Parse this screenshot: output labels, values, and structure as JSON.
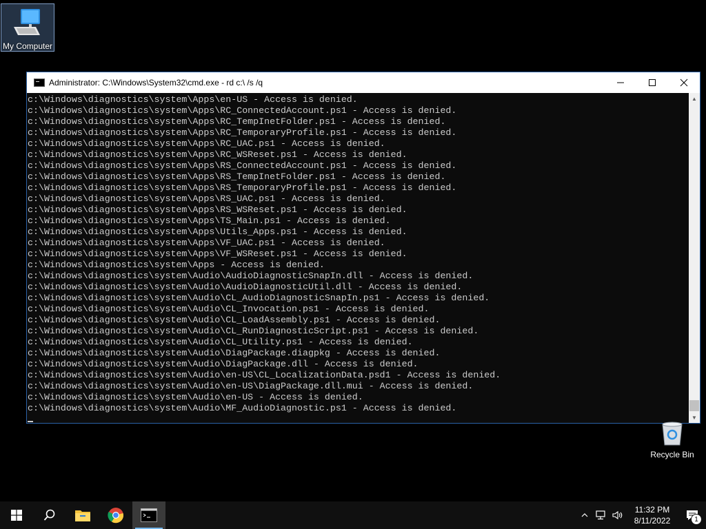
{
  "desktop": {
    "my_computer_label": "My Computer",
    "recycle_bin_label": "Recycle Bin"
  },
  "window": {
    "title": "Administrator: C:\\Windows\\System32\\cmd.exe - rd  c:\\ /s /q",
    "minimize_glyph": "—",
    "maximize_glyph": "☐",
    "close_glyph": "✕"
  },
  "console": {
    "lines": [
      "c:\\Windows\\diagnostics\\system\\Apps\\en-US - Access is denied.",
      "c:\\Windows\\diagnostics\\system\\Apps\\RC_ConnectedAccount.ps1 - Access is denied.",
      "c:\\Windows\\diagnostics\\system\\Apps\\RC_TempInetFolder.ps1 - Access is denied.",
      "c:\\Windows\\diagnostics\\system\\Apps\\RC_TemporaryProfile.ps1 - Access is denied.",
      "c:\\Windows\\diagnostics\\system\\Apps\\RC_UAC.ps1 - Access is denied.",
      "c:\\Windows\\diagnostics\\system\\Apps\\RC_WSReset.ps1 - Access is denied.",
      "c:\\Windows\\diagnostics\\system\\Apps\\RS_ConnectedAccount.ps1 - Access is denied.",
      "c:\\Windows\\diagnostics\\system\\Apps\\RS_TempInetFolder.ps1 - Access is denied.",
      "c:\\Windows\\diagnostics\\system\\Apps\\RS_TemporaryProfile.ps1 - Access is denied.",
      "c:\\Windows\\diagnostics\\system\\Apps\\RS_UAC.ps1 - Access is denied.",
      "c:\\Windows\\diagnostics\\system\\Apps\\RS_WSReset.ps1 - Access is denied.",
      "c:\\Windows\\diagnostics\\system\\Apps\\TS_Main.ps1 - Access is denied.",
      "c:\\Windows\\diagnostics\\system\\Apps\\Utils_Apps.ps1 - Access is denied.",
      "c:\\Windows\\diagnostics\\system\\Apps\\VF_UAC.ps1 - Access is denied.",
      "c:\\Windows\\diagnostics\\system\\Apps\\VF_WSReset.ps1 - Access is denied.",
      "c:\\Windows\\diagnostics\\system\\Apps - Access is denied.",
      "c:\\Windows\\diagnostics\\system\\Audio\\AudioDiagnosticSnapIn.dll - Access is denied.",
      "c:\\Windows\\diagnostics\\system\\Audio\\AudioDiagnosticUtil.dll - Access is denied.",
      "c:\\Windows\\diagnostics\\system\\Audio\\CL_AudioDiagnosticSnapIn.ps1 - Access is denied.",
      "c:\\Windows\\diagnostics\\system\\Audio\\CL_Invocation.ps1 - Access is denied.",
      "c:\\Windows\\diagnostics\\system\\Audio\\CL_LoadAssembly.ps1 - Access is denied.",
      "c:\\Windows\\diagnostics\\system\\Audio\\CL_RunDiagnosticScript.ps1 - Access is denied.",
      "c:\\Windows\\diagnostics\\system\\Audio\\CL_Utility.ps1 - Access is denied.",
      "c:\\Windows\\diagnostics\\system\\Audio\\DiagPackage.diagpkg - Access is denied.",
      "c:\\Windows\\diagnostics\\system\\Audio\\DiagPackage.dll - Access is denied.",
      "c:\\Windows\\diagnostics\\system\\Audio\\en-US\\CL_LocalizationData.psd1 - Access is denied.",
      "c:\\Windows\\diagnostics\\system\\Audio\\en-US\\DiagPackage.dll.mui - Access is denied.",
      "c:\\Windows\\diagnostics\\system\\Audio\\en-US - Access is denied.",
      "c:\\Windows\\diagnostics\\system\\Audio\\MF_AudioDiagnostic.ps1 - Access is denied."
    ]
  },
  "taskbar": {
    "start_icon": "windows-start-icon",
    "search_icon": "search-icon",
    "pinned": [
      "file-explorer-icon",
      "chrome-icon",
      "cmd-icon"
    ],
    "tray": {
      "chevron_glyph": "⌃",
      "time": "11:32 PM",
      "date": "8/11/2022",
      "notification_count": "1"
    }
  },
  "colors": {
    "console_bg": "#0c0c0c",
    "console_fg": "#cccccc",
    "window_border": "#2b62a8",
    "taskbar_bg": "#101010",
    "active_indicator": "#76b9ed"
  }
}
